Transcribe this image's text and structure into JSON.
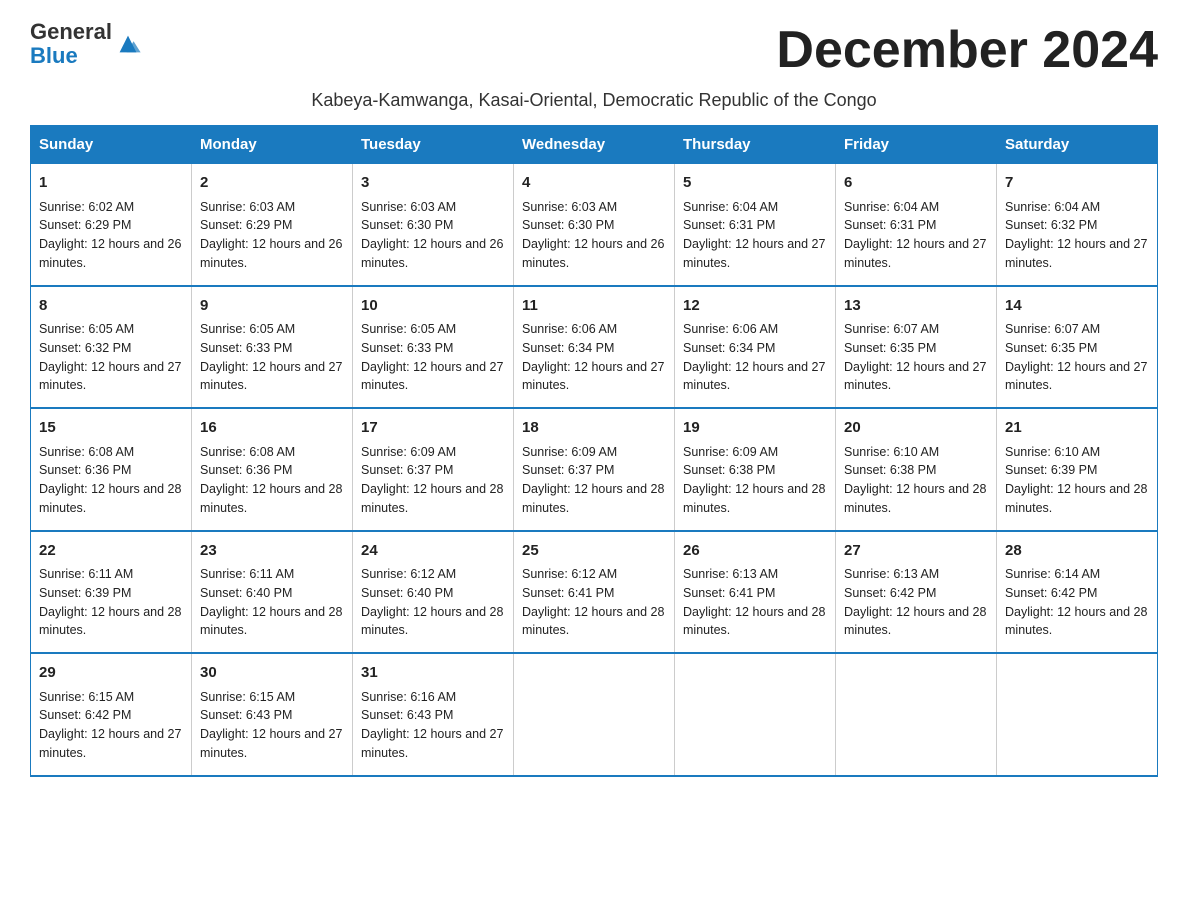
{
  "header": {
    "logo_general": "General",
    "logo_blue": "Blue",
    "month_title": "December 2024",
    "subtitle": "Kabeya-Kamwanga, Kasai-Oriental, Democratic Republic of the Congo"
  },
  "days_of_week": [
    "Sunday",
    "Monday",
    "Tuesday",
    "Wednesday",
    "Thursday",
    "Friday",
    "Saturday"
  ],
  "weeks": [
    [
      {
        "day": "1",
        "sunrise": "6:02 AM",
        "sunset": "6:29 PM",
        "daylight": "12 hours and 26 minutes."
      },
      {
        "day": "2",
        "sunrise": "6:03 AM",
        "sunset": "6:29 PM",
        "daylight": "12 hours and 26 minutes."
      },
      {
        "day": "3",
        "sunrise": "6:03 AM",
        "sunset": "6:30 PM",
        "daylight": "12 hours and 26 minutes."
      },
      {
        "day": "4",
        "sunrise": "6:03 AM",
        "sunset": "6:30 PM",
        "daylight": "12 hours and 26 minutes."
      },
      {
        "day": "5",
        "sunrise": "6:04 AM",
        "sunset": "6:31 PM",
        "daylight": "12 hours and 27 minutes."
      },
      {
        "day": "6",
        "sunrise": "6:04 AM",
        "sunset": "6:31 PM",
        "daylight": "12 hours and 27 minutes."
      },
      {
        "day": "7",
        "sunrise": "6:04 AM",
        "sunset": "6:32 PM",
        "daylight": "12 hours and 27 minutes."
      }
    ],
    [
      {
        "day": "8",
        "sunrise": "6:05 AM",
        "sunset": "6:32 PM",
        "daylight": "12 hours and 27 minutes."
      },
      {
        "day": "9",
        "sunrise": "6:05 AM",
        "sunset": "6:33 PM",
        "daylight": "12 hours and 27 minutes."
      },
      {
        "day": "10",
        "sunrise": "6:05 AM",
        "sunset": "6:33 PM",
        "daylight": "12 hours and 27 minutes."
      },
      {
        "day": "11",
        "sunrise": "6:06 AM",
        "sunset": "6:34 PM",
        "daylight": "12 hours and 27 minutes."
      },
      {
        "day": "12",
        "sunrise": "6:06 AM",
        "sunset": "6:34 PM",
        "daylight": "12 hours and 27 minutes."
      },
      {
        "day": "13",
        "sunrise": "6:07 AM",
        "sunset": "6:35 PM",
        "daylight": "12 hours and 27 minutes."
      },
      {
        "day": "14",
        "sunrise": "6:07 AM",
        "sunset": "6:35 PM",
        "daylight": "12 hours and 27 minutes."
      }
    ],
    [
      {
        "day": "15",
        "sunrise": "6:08 AM",
        "sunset": "6:36 PM",
        "daylight": "12 hours and 28 minutes."
      },
      {
        "day": "16",
        "sunrise": "6:08 AM",
        "sunset": "6:36 PM",
        "daylight": "12 hours and 28 minutes."
      },
      {
        "day": "17",
        "sunrise": "6:09 AM",
        "sunset": "6:37 PM",
        "daylight": "12 hours and 28 minutes."
      },
      {
        "day": "18",
        "sunrise": "6:09 AM",
        "sunset": "6:37 PM",
        "daylight": "12 hours and 28 minutes."
      },
      {
        "day": "19",
        "sunrise": "6:09 AM",
        "sunset": "6:38 PM",
        "daylight": "12 hours and 28 minutes."
      },
      {
        "day": "20",
        "sunrise": "6:10 AM",
        "sunset": "6:38 PM",
        "daylight": "12 hours and 28 minutes."
      },
      {
        "day": "21",
        "sunrise": "6:10 AM",
        "sunset": "6:39 PM",
        "daylight": "12 hours and 28 minutes."
      }
    ],
    [
      {
        "day": "22",
        "sunrise": "6:11 AM",
        "sunset": "6:39 PM",
        "daylight": "12 hours and 28 minutes."
      },
      {
        "day": "23",
        "sunrise": "6:11 AM",
        "sunset": "6:40 PM",
        "daylight": "12 hours and 28 minutes."
      },
      {
        "day": "24",
        "sunrise": "6:12 AM",
        "sunset": "6:40 PM",
        "daylight": "12 hours and 28 minutes."
      },
      {
        "day": "25",
        "sunrise": "6:12 AM",
        "sunset": "6:41 PM",
        "daylight": "12 hours and 28 minutes."
      },
      {
        "day": "26",
        "sunrise": "6:13 AM",
        "sunset": "6:41 PM",
        "daylight": "12 hours and 28 minutes."
      },
      {
        "day": "27",
        "sunrise": "6:13 AM",
        "sunset": "6:42 PM",
        "daylight": "12 hours and 28 minutes."
      },
      {
        "day": "28",
        "sunrise": "6:14 AM",
        "sunset": "6:42 PM",
        "daylight": "12 hours and 28 minutes."
      }
    ],
    [
      {
        "day": "29",
        "sunrise": "6:15 AM",
        "sunset": "6:42 PM",
        "daylight": "12 hours and 27 minutes."
      },
      {
        "day": "30",
        "sunrise": "6:15 AM",
        "sunset": "6:43 PM",
        "daylight": "12 hours and 27 minutes."
      },
      {
        "day": "31",
        "sunrise": "6:16 AM",
        "sunset": "6:43 PM",
        "daylight": "12 hours and 27 minutes."
      },
      null,
      null,
      null,
      null
    ]
  ],
  "labels": {
    "sunrise": "Sunrise:",
    "sunset": "Sunset:",
    "daylight": "Daylight:"
  }
}
